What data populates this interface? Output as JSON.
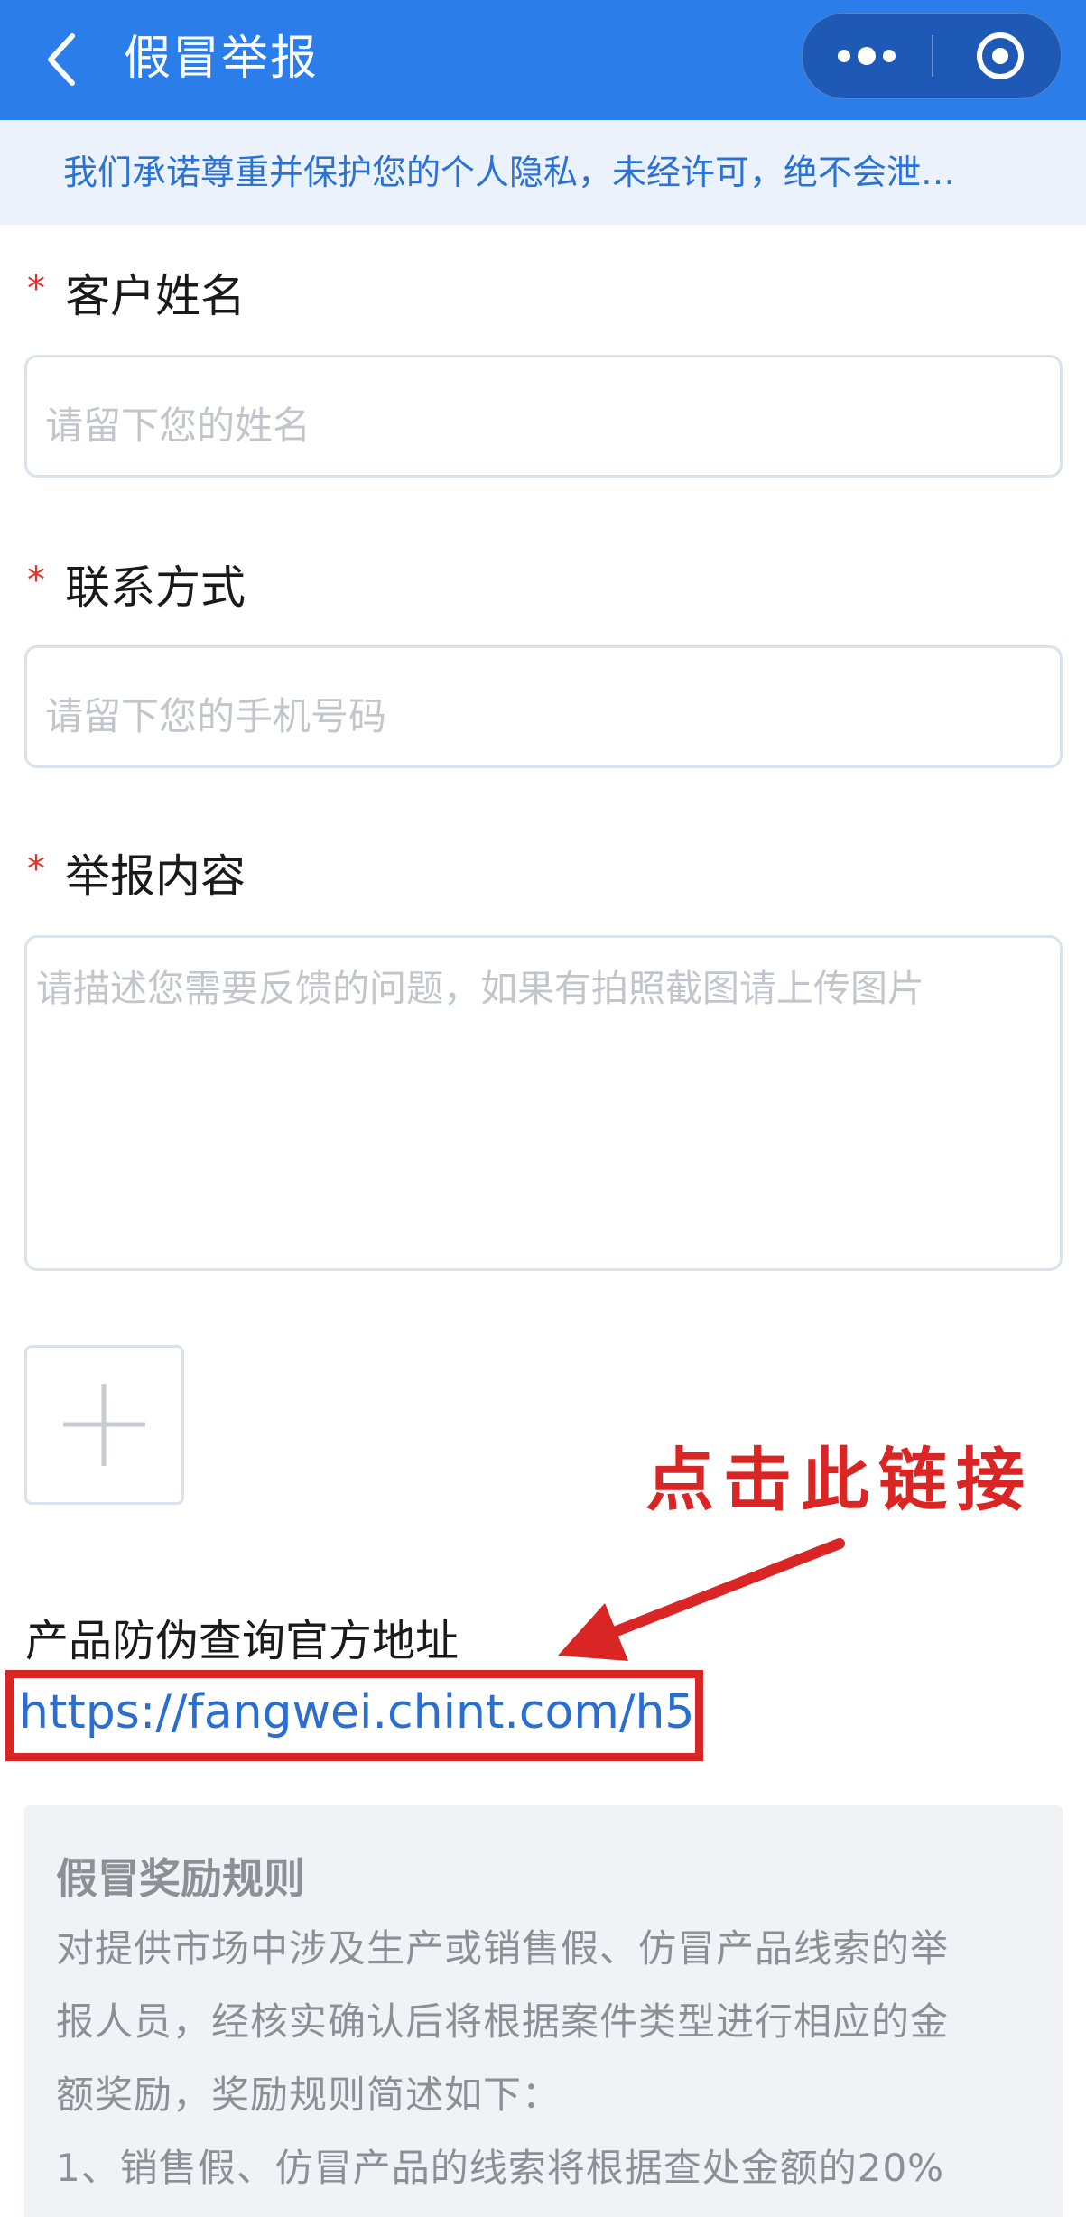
{
  "header": {
    "title": "假冒举报",
    "back_icon": "chevron-left-icon",
    "more_icon": "more-dots-icon",
    "close_icon": "target-circle-icon",
    "bg_color": "#2b7de9"
  },
  "privacy_notice": "我们承诺尊重并保护您的个人隐私，未经许可，绝不会泄…",
  "form": {
    "required_mark": "*",
    "name": {
      "label": "客户姓名",
      "placeholder": "请留下您的姓名"
    },
    "contact": {
      "label": "联系方式",
      "placeholder": "请留下您的手机号码"
    },
    "content": {
      "label": "举报内容",
      "placeholder": "请描述您需要反馈的问题，如果有拍照截图请上传图片"
    },
    "upload_icon": "plus-icon"
  },
  "annotation": {
    "text": "点击此链接",
    "color": "#d92524"
  },
  "official": {
    "label": "产品防伪查询官方地址",
    "url": "https://fangwei.chint.com/h5"
  },
  "rules": {
    "title": "假冒奖励规则",
    "lines": [
      "对提供市场中涉及生产或销售假、仿冒产品线索的举",
      "报人员，经核实确认后将根据案件类型进行相应的金",
      "额奖励，奖励规则简述如下：",
      "1、销售假、仿冒产品的线索将根据查处金额的20%"
    ]
  }
}
